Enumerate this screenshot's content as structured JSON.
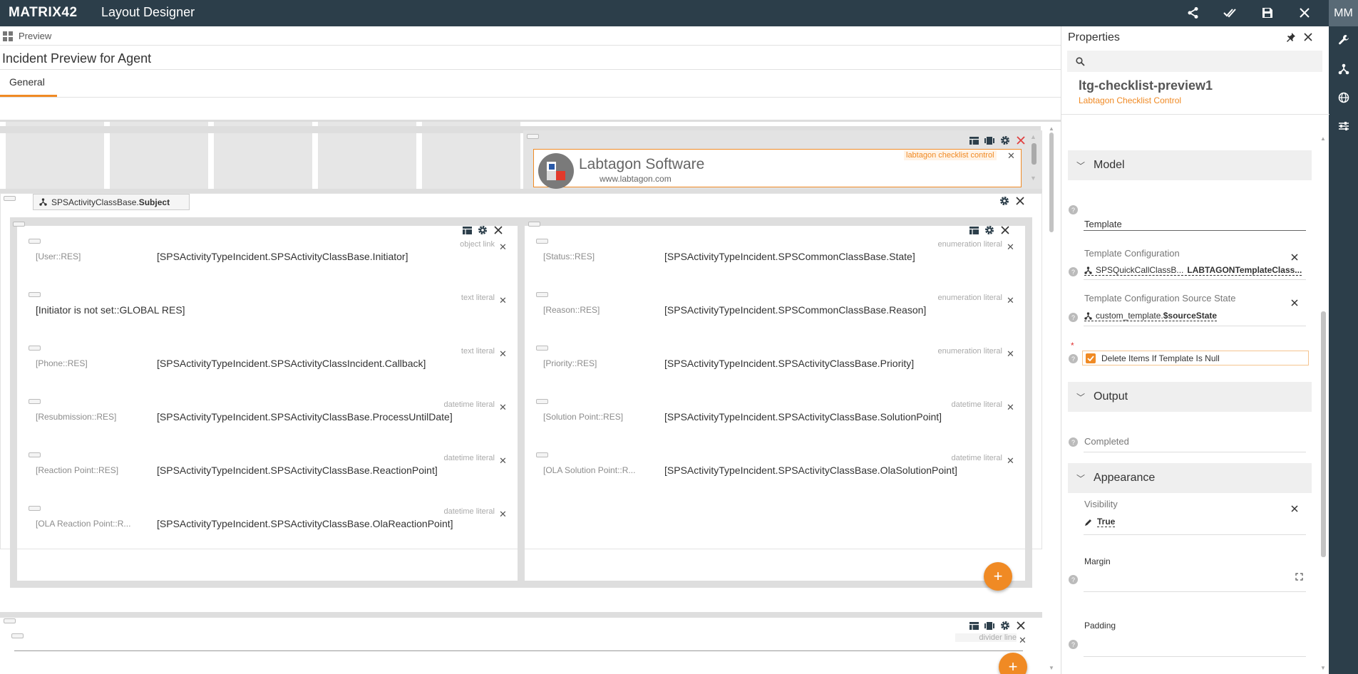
{
  "app": {
    "brand": "MATRIX42",
    "title": "Layout Designer",
    "avatar": "MM",
    "colors": {
      "accent": "#f08a24",
      "topbar": "#2c3e4a"
    },
    "toolbar_icons": [
      "share-icon",
      "check-all-icon",
      "save-icon",
      "close-icon"
    ],
    "rail_icons": [
      "wrench-icon",
      "hierarchy-icon",
      "globe-icon",
      "sliders-icon"
    ]
  },
  "header": {
    "breadcrumb": "Preview",
    "page_title": "Incident Preview for Agent",
    "tabs": [
      {
        "label": "General"
      }
    ]
  },
  "canvas": {
    "checklist_tag": "labtagon checklist control",
    "labtagon_logo_name": "Labtagon Software",
    "labtagon_logo_url": "www.labtagon.com",
    "subject_binding_prefix": "SPSActivityClassBase.",
    "subject_binding_suffix": "Subject",
    "left_rows": [
      {
        "label": "[User::RES]",
        "value": "[SPSActivityTypeIncident.SPSActivityClassBase.Initiator]",
        "tag": "object link"
      },
      {
        "label": "",
        "value": "[Initiator is not set::GLOBAL RES]",
        "tag": "text literal"
      },
      {
        "label": "[Phone::RES]",
        "value": "[SPSActivityTypeIncident.SPSActivityClassIncident.Callback]",
        "tag": "text literal"
      },
      {
        "label": "[Resubmission::RES]",
        "value": "[SPSActivityTypeIncident.SPSActivityClassBase.ProcessUntilDate]",
        "tag": "datetime literal"
      },
      {
        "label": "[Reaction Point::RES]",
        "value": "[SPSActivityTypeIncident.SPSActivityClassBase.ReactionPoint]",
        "tag": "datetime literal"
      },
      {
        "label": "[OLA Reaction Point::R...",
        "value": "[SPSActivityTypeIncident.SPSActivityClassBase.OlaReactionPoint]",
        "tag": "datetime literal"
      }
    ],
    "right_rows": [
      {
        "label": "[Status::RES]",
        "value": "[SPSActivityTypeIncident.SPSCommonClassBase.State]",
        "tag": "enumeration literal"
      },
      {
        "label": "[Reason::RES]",
        "value": "[SPSActivityTypeIncident.SPSCommonClassBase.Reason]",
        "tag": "enumeration literal"
      },
      {
        "label": "[Priority::RES]",
        "value": "[SPSActivityTypeIncident.SPSActivityClassBase.Priority]",
        "tag": "enumeration literal"
      },
      {
        "label": "[Solution Point::RES]",
        "value": "[SPSActivityTypeIncident.SPSActivityClassBase.SolutionPoint]",
        "tag": "datetime literal"
      },
      {
        "label": "[OLA Solution Point::R...",
        "value": "[SPSActivityTypeIncident.SPSActivityClassBase.OlaSolutionPoint]",
        "tag": "datetime literal"
      }
    ],
    "divider_tag": "divider line",
    "add_label": "+"
  },
  "properties": {
    "title": "Properties",
    "control_name": "ltg-checklist-preview1",
    "control_type": "Labtagon Checklist Control",
    "sections": {
      "model": "Model",
      "output": "Output",
      "appearance": "Appearance"
    },
    "template": "Template",
    "template_config_label": "Template Configuration",
    "template_config_value_prefix": "SPSQuickCallClassB...",
    "template_config_value_suffix": "LABTAGONTemplateClass...",
    "source_state_label": "Template Configuration Source State",
    "source_state_value_prefix": "custom_template.",
    "source_state_value_suffix": "$sourceState",
    "required_marker": "*",
    "delete_items_label": "Delete Items If Template Is Null",
    "delete_items_checked": true,
    "completed_label": "Completed",
    "visibility_label": "Visibility",
    "visibility_value": "True",
    "margin_label": "Margin",
    "padding_label": "Padding"
  }
}
